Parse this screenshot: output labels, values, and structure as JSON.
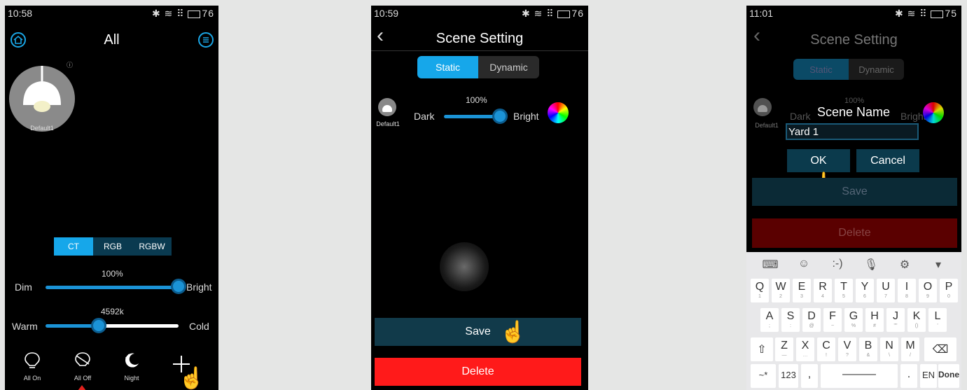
{
  "phone1": {
    "status": {
      "time": "10:58",
      "icons": "✱ ≋ ⠿",
      "battery": "76"
    },
    "title": "All",
    "device_name": "Default1",
    "mode_tabs": [
      "CT",
      "RGB",
      "RGBW"
    ],
    "brightness": {
      "value_label": "100%",
      "min_label": "Dim",
      "max_label": "Bright",
      "level": 1.0
    },
    "color_temp": {
      "value_label": "4592k",
      "min_label": "Warm",
      "max_label": "Cold",
      "level": 0.4
    },
    "bottom_actions": [
      {
        "label": "All On"
      },
      {
        "label": "All Off"
      },
      {
        "label": "Night"
      },
      {
        "label": ""
      }
    ],
    "accent": "#1aa6e6"
  },
  "phone2": {
    "status": {
      "time": "10:59",
      "icons": "✱ ≋ ⠿",
      "battery": "76"
    },
    "back_glyph": "‹",
    "title": "Scene Setting",
    "tabs": [
      "Static",
      "Dynamic"
    ],
    "device_name": "Default1",
    "brightness": {
      "value_label": "100%",
      "min_label": "Dark",
      "max_label": "Bright",
      "level": 1.0
    },
    "save_label": "Save",
    "delete_label": "Delete",
    "delete_color": "#ff1a1a"
  },
  "phone3": {
    "status": {
      "time": "11:01",
      "icons": "✱ ≋ ⠿",
      "battery": "75"
    },
    "back_glyph": "‹",
    "title": "Scene Setting",
    "tabs": [
      "Static",
      "Dynamic"
    ],
    "device_name": "Default1",
    "bg_brightness_label": "100%",
    "bg_min_label": "Dark",
    "bg_max_label": "Bright",
    "dialog": {
      "title": "Scene Name",
      "input_value": "Yard 1",
      "ok_label": "OK",
      "cancel_label": "Cancel"
    },
    "save_label": "Save",
    "delete_label": "Delete",
    "keyboard": {
      "toolbar": [
        "⌨",
        "☺",
        ":-)",
        "🎙",
        "⚙",
        "▾"
      ],
      "row1": [
        [
          "Q",
          "1"
        ],
        [
          "W",
          "2"
        ],
        [
          "E",
          "3"
        ],
        [
          "R",
          "4"
        ],
        [
          "T",
          "5"
        ],
        [
          "Y",
          "6"
        ],
        [
          "U",
          "7"
        ],
        [
          "I",
          "8"
        ],
        [
          "O",
          "9"
        ],
        [
          "P",
          "0"
        ]
      ],
      "row2": [
        [
          "A",
          ";"
        ],
        [
          "S",
          ":"
        ],
        [
          "D",
          "@"
        ],
        [
          "F",
          "~"
        ],
        [
          "G",
          "%"
        ],
        [
          "H",
          "#"
        ],
        [
          "J",
          "\"\""
        ],
        [
          "K",
          "()"
        ],
        [
          "L",
          "'"
        ]
      ],
      "row3": [
        [
          "Z",
          "—"
        ],
        [
          "X",
          "…"
        ],
        [
          "C",
          "!"
        ],
        [
          "V",
          "?"
        ],
        [
          "B",
          "&"
        ],
        [
          "N",
          "\\"
        ],
        [
          "M",
          "/"
        ]
      ],
      "shift": "⇧",
      "backspace": "⌫",
      "symbols": "~*",
      "numbers": "123",
      "comma": ",",
      "period": ".",
      "lang": "EN",
      "done": "Done"
    }
  }
}
